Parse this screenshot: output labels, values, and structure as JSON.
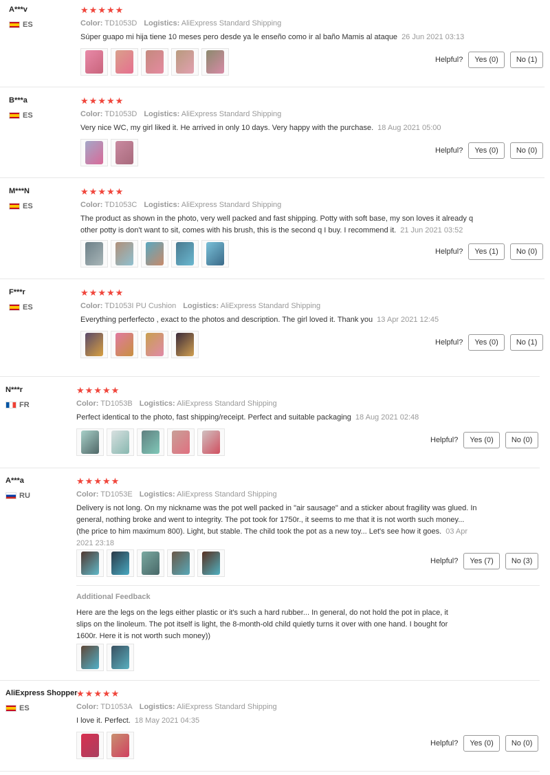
{
  "star_glyph": "★",
  "helpful_label": "Helpful?",
  "color_label": "Color:",
  "logistics_label": "Logistics:",
  "reviews": [
    {
      "user": "A***v",
      "country": "ES",
      "color": "TD1053D",
      "logistics": "AliExpress Standard Shipping",
      "text": "Súper guapo mi hija tiene 10 meses pero desde ya le enseño como ir al baño Mamis al ataque",
      "date": "26 Jun 2021 03:13",
      "yes": "Yes (0)",
      "no": "No (1)"
    },
    {
      "user": "B***a",
      "country": "ES",
      "color": "TD1053D",
      "logistics": "AliExpress Standard Shipping",
      "text": "Very nice WC, my girl liked it. He arrived in only 10 days. Very happy with the purchase.",
      "date": "18 Aug 2021 05:00",
      "yes": "Yes (0)",
      "no": "No (0)"
    },
    {
      "user": "M***N",
      "country": "ES",
      "color": "TD1053C",
      "logistics": "AliExpress Standard Shipping",
      "text": "The product as shown in the photo, very well packed and fast shipping. Potty with soft base, my son loves it already q other potty is don't want to sit, comes with his brush, this is the second q I buy. I recommend it.",
      "date": "21 Jun 2021 03:52",
      "yes": "Yes (1)",
      "no": "No (0)"
    },
    {
      "user": "F***r",
      "country": "ES",
      "color": "TD1053I PU Cushion",
      "logistics": "AliExpress Standard Shipping",
      "text": "Everything perferfecto , exact to the photos and description. The girl loved it. Thank you",
      "date": "13 Apr 2021 12:45",
      "yes": "Yes (0)",
      "no": "No (1)"
    },
    {
      "user": "N***r",
      "country": "FR",
      "color": "TD1053B",
      "logistics": "AliExpress Standard Shipping",
      "text": "Perfect identical to the photo, fast shipping/receipt. Perfect and suitable packaging",
      "date": "18 Aug 2021 02:48",
      "yes": "Yes (0)",
      "no": "No (0)"
    },
    {
      "user": "A***a",
      "country": "RU",
      "color": "TD1053E",
      "logistics": "AliExpress Standard Shipping",
      "text": "Delivery is not long. On my nickname was the pot well packed in \"air sausage\" and a sticker about fragility was glued. In general, nothing broke and went to integrity. The pot took for 1750r., it seems to me that it is not worth such money... (the price to him maximum 800). Light, but stable. The child took the pot as a new toy... Let's see how it goes.",
      "date": "03 Apr 2021 23:18",
      "yes": "Yes (7)",
      "no": "No (3)",
      "additional_label": "Additional Feedback",
      "additional_text": "Here are the legs on the legs either plastic or it's such a hard rubber... In general, do not hold the pot in place, it slips on the linoleum. The pot itself is light, the 8-month-old child quietly turns it over with one hand. I bought for 1600r. Here it is not worth such money))"
    },
    {
      "user": "AliExpress Shopper",
      "country": "ES",
      "color": "TD1053A",
      "logistics": "AliExpress Standard Shipping",
      "text": "I love it. Perfect.",
      "date": "18 May 2021 04:35",
      "yes": "Yes (0)",
      "no": "No (0)"
    }
  ]
}
